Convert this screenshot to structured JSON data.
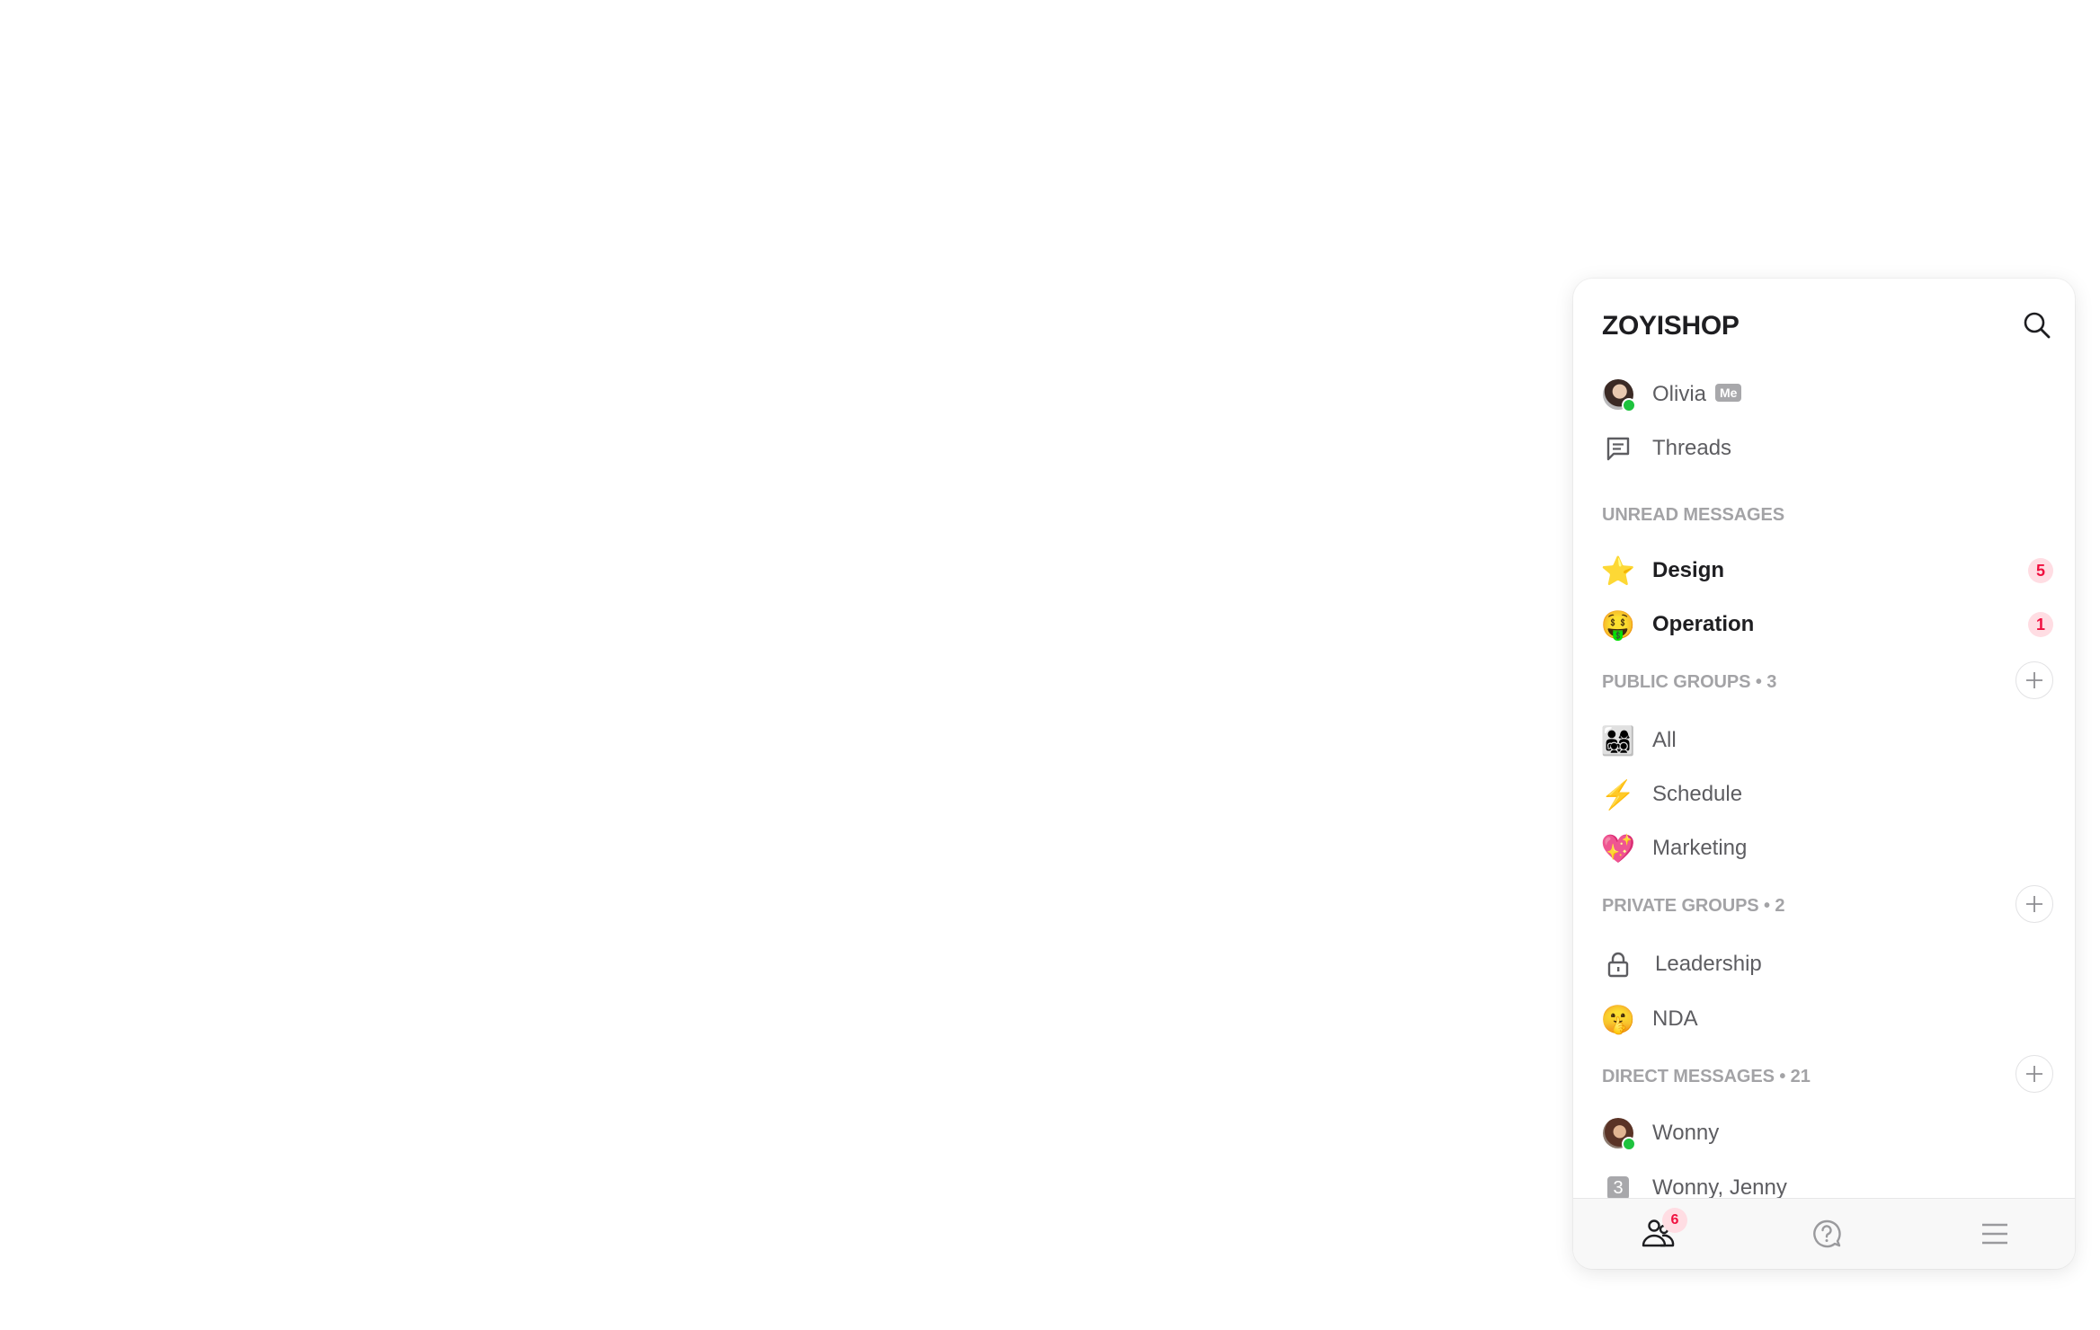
{
  "workspace": {
    "title": "ZOYISHOP"
  },
  "top_items": [
    {
      "label": "Olivia",
      "tag": "Me",
      "icon": "avatar-olivia",
      "online": true
    },
    {
      "label": "Threads",
      "icon": "threads-icon"
    }
  ],
  "unread": {
    "title": "UNREAD MESSAGES",
    "items": [
      {
        "label": "Design",
        "emoji": "⭐",
        "count": "5"
      },
      {
        "label": "Operation",
        "emoji": "🤑",
        "count": "1"
      }
    ]
  },
  "public_groups": {
    "title": "PUBLIC GROUPS • 3",
    "items": [
      {
        "label": "All",
        "emoji": "👨‍👩‍👧‍👦"
      },
      {
        "label": "Schedule",
        "emoji": "⚡"
      },
      {
        "label": "Marketing",
        "emoji": "💖"
      }
    ]
  },
  "private_groups": {
    "title": "PRIVATE GROUPS • 2",
    "items": [
      {
        "label": "Leadership",
        "icon": "lock-icon"
      },
      {
        "label": "NDA",
        "emoji": "🤫"
      }
    ]
  },
  "direct_messages": {
    "title": "DIRECT MESSAGES • 21",
    "items": [
      {
        "label": "Wonny",
        "icon": "avatar-wonny",
        "online": true
      },
      {
        "label": "Wonny, Jenny",
        "member_count": "3"
      }
    ]
  },
  "footer": {
    "tabs": [
      {
        "name": "people",
        "icon": "people-icon",
        "badge": "6",
        "active": true
      },
      {
        "name": "help",
        "icon": "help-chat-icon"
      },
      {
        "name": "menu",
        "icon": "hamburger-menu-icon"
      }
    ]
  },
  "colors": {
    "badge_bg": "#ffdde3",
    "badge_text": "#f0103f",
    "online": "#1ec33e"
  }
}
